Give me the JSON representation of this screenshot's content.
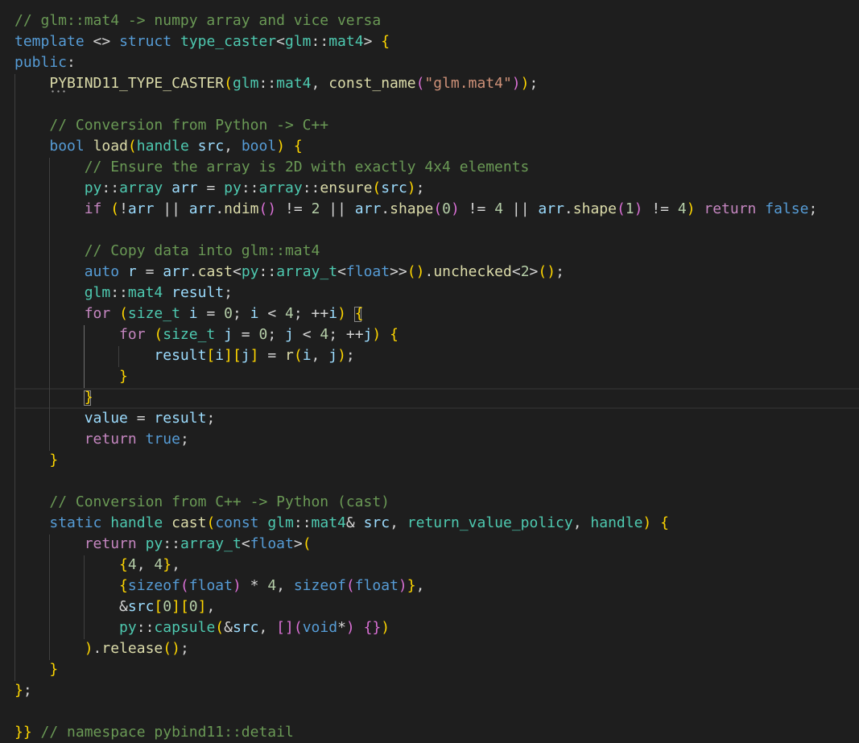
{
  "editor": {
    "lines": [
      {
        "text": "// glm::mat4 -> numpy array and vice versa"
      },
      {
        "text": "template <> struct type_caster<glm::mat4> {"
      },
      {
        "text": "public:"
      },
      {
        "text": "    PYBIND11_TYPE_CASTER(glm::mat4, const_name(\"glm.mat4\"));"
      },
      {
        "text": ""
      },
      {
        "text": "    // Conversion from Python -> C++"
      },
      {
        "text": "    bool load(handle src, bool) {"
      },
      {
        "text": "        // Ensure the array is 2D with exactly 4x4 elements"
      },
      {
        "text": "        py::array arr = py::array::ensure(src);"
      },
      {
        "text": "        if (!arr || arr.ndim() != 2 || arr.shape(0) != 4 || arr.shape(1) != 4) return false;"
      },
      {
        "text": ""
      },
      {
        "text": "        // Copy data into glm::mat4"
      },
      {
        "text": "        auto r = arr.cast<py::array_t<float>>().unchecked<2>();"
      },
      {
        "text": "        glm::mat4 result;"
      },
      {
        "text": "        for (size_t i = 0; i < 4; ++i) {"
      },
      {
        "text": "            for (size_t j = 0; j < 4; ++j) {"
      },
      {
        "text": "                result[i][j] = r(i, j);"
      },
      {
        "text": "            }"
      },
      {
        "text": "        }"
      },
      {
        "text": "        value = result;"
      },
      {
        "text": "        return true;"
      },
      {
        "text": "    }"
      },
      {
        "text": ""
      },
      {
        "text": "    // Conversion from C++ -> Python (cast)"
      },
      {
        "text": "    static handle cast(const glm::mat4& src, return_value_policy, handle) {"
      },
      {
        "text": "        return py::array_t<float>("
      },
      {
        "text": "            {4, 4},"
      },
      {
        "text": "            {sizeof(float) * 4, sizeof(float)},"
      },
      {
        "text": "            &src[0][0],"
      },
      {
        "text": "            py::capsule(&src, [](void*) {})"
      },
      {
        "text": "        ).release();"
      },
      {
        "text": "    }"
      },
      {
        "text": "};"
      },
      {
        "text": ""
      },
      {
        "text": "}} // namespace pybind11::detail"
      }
    ]
  },
  "colors": {
    "background": "#1e1e1e",
    "comment": "#6a9955",
    "keyword": "#569cd6",
    "control_keyword": "#c586c0",
    "type": "#4ec9b0",
    "function": "#dcdcaa",
    "variable": "#9cdcfe",
    "string": "#ce9178",
    "number": "#b5cea8",
    "bracket_level_1": "#ffd700",
    "bracket_level_2": "#da70d6",
    "bracket_level_3": "#179fff"
  }
}
